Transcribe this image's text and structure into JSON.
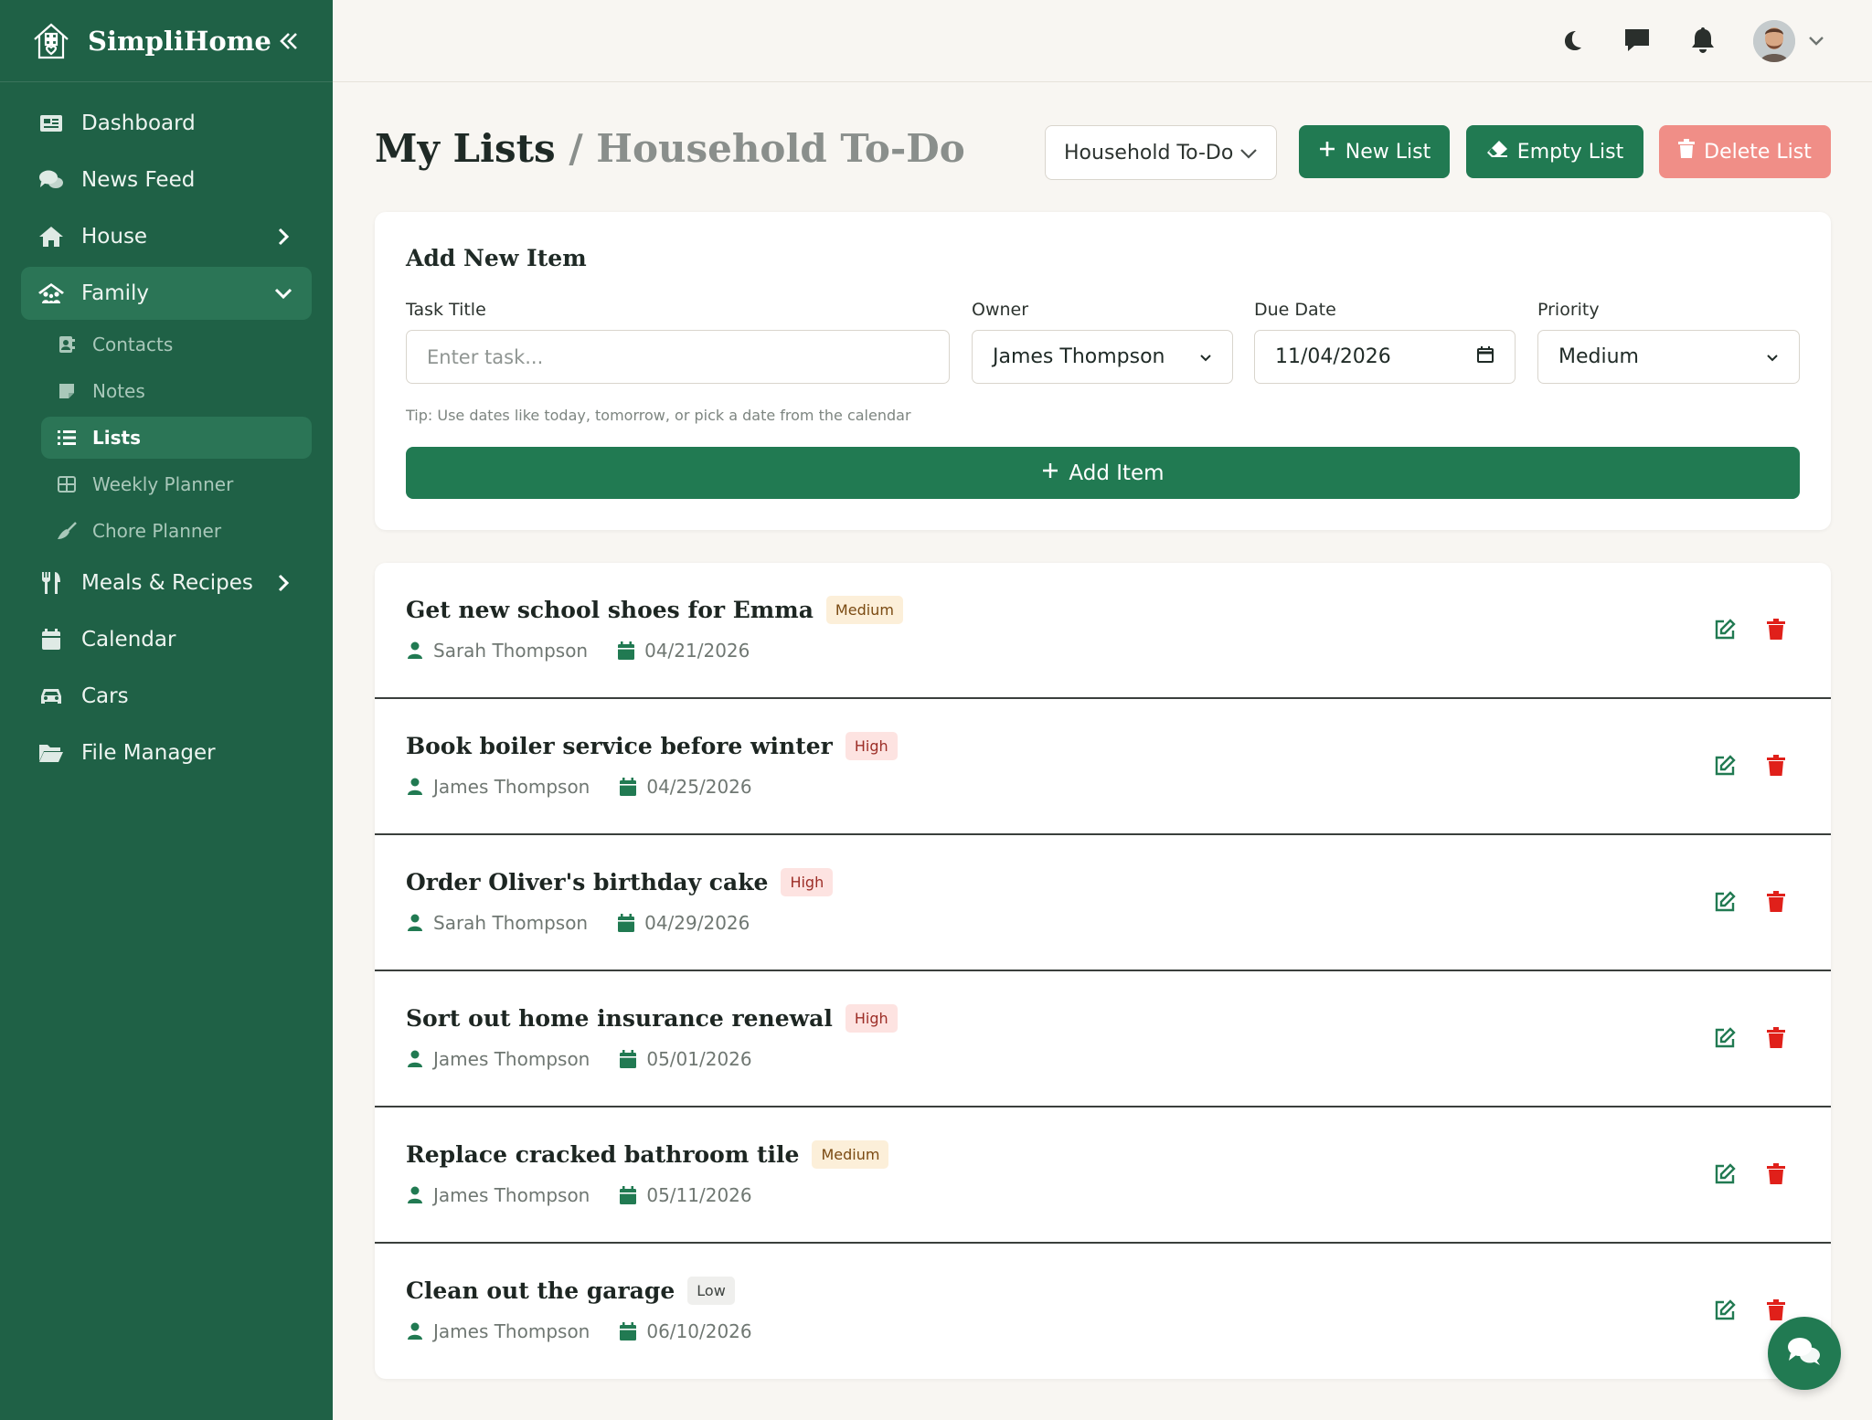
{
  "brand": {
    "name": "SimpliHome"
  },
  "sidebar": {
    "items": [
      {
        "label": "Dashboard",
        "icon": "newspaper-icon"
      },
      {
        "label": "News Feed",
        "icon": "comments-icon"
      },
      {
        "label": "House",
        "icon": "home-icon"
      },
      {
        "label": "Family",
        "icon": "family-icon"
      },
      {
        "label": "Meals & Recipes",
        "icon": "utensils-icon"
      },
      {
        "label": "Calendar",
        "icon": "calendar-icon"
      },
      {
        "label": "Cars",
        "icon": "car-icon"
      },
      {
        "label": "File Manager",
        "icon": "folder-icon"
      }
    ],
    "family_sub": [
      {
        "label": "Contacts",
        "icon": "address-book-icon"
      },
      {
        "label": "Notes",
        "icon": "note-icon"
      },
      {
        "label": "Lists",
        "icon": "list-icon"
      },
      {
        "label": "Weekly Planner",
        "icon": "grid-icon"
      },
      {
        "label": "Chore Planner",
        "icon": "broom-icon"
      }
    ]
  },
  "header": {
    "title": "My Lists",
    "separator": "/",
    "subtitle": "Household To-Do",
    "list_select": "Household To-Do",
    "new_list": "New List",
    "empty_list": "Empty List",
    "delete_list": "Delete List"
  },
  "add_item": {
    "heading": "Add New Item",
    "task_label": "Task Title",
    "task_placeholder": "Enter task...",
    "owner_label": "Owner",
    "owner_value": "James Thompson",
    "due_label": "Due Date",
    "due_value": "11/04/2026",
    "priority_label": "Priority",
    "priority_value": "Medium",
    "tip": "Tip: Use dates like today, tomorrow, or pick a date from the calendar",
    "button": "Add Item"
  },
  "tasks": [
    {
      "title": "Get new school shoes for Emma",
      "priority": "Medium",
      "owner": "Sarah Thompson",
      "due": "04/21/2026"
    },
    {
      "title": "Book boiler service before winter",
      "priority": "High",
      "owner": "James Thompson",
      "due": "04/25/2026"
    },
    {
      "title": "Order Oliver's birthday cake",
      "priority": "High",
      "owner": "Sarah Thompson",
      "due": "04/29/2026"
    },
    {
      "title": "Sort out home insurance renewal",
      "priority": "High",
      "owner": "James Thompson",
      "due": "05/01/2026"
    },
    {
      "title": "Replace cracked bathroom tile",
      "priority": "Medium",
      "owner": "James Thompson",
      "due": "05/11/2026"
    },
    {
      "title": "Clean out the garage",
      "priority": "Low",
      "owner": "James Thompson",
      "due": "06/10/2026"
    }
  ],
  "colors": {
    "sidebar": "#1f6146",
    "accent": "#217a52",
    "danger": "#f08e87",
    "delete_icon": "#e0201a"
  }
}
